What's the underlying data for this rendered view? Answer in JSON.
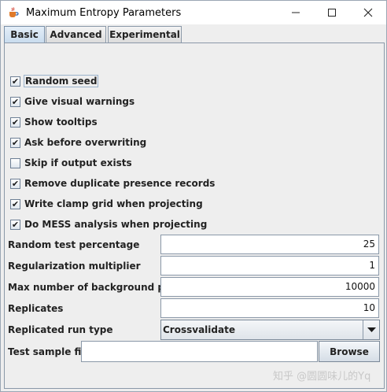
{
  "window": {
    "title": "Maximum Entropy Parameters",
    "controls": {
      "minimize": "—",
      "maximize": "☐",
      "close": "✕"
    }
  },
  "tabs": [
    {
      "label": "Basic",
      "active": true
    },
    {
      "label": "Advanced",
      "active": false
    },
    {
      "label": "Experimental",
      "active": false
    }
  ],
  "checkboxes": [
    {
      "label": "Random seed",
      "checked": true
    },
    {
      "label": "Give visual warnings",
      "checked": true
    },
    {
      "label": "Show tooltips",
      "checked": true
    },
    {
      "label": "Ask before overwriting",
      "checked": true
    },
    {
      "label": "Skip if output exists",
      "checked": false
    },
    {
      "label": "Remove duplicate presence records",
      "checked": true
    },
    {
      "label": "Write clamp grid when projecting",
      "checked": true
    },
    {
      "label": "Do MESS analysis when projecting",
      "checked": true
    }
  ],
  "fields": [
    {
      "label": "Random test percentage",
      "value": "25"
    },
    {
      "label": "Regularization multiplier",
      "value": "1"
    },
    {
      "label": "Max number of background points",
      "value": "10000"
    },
    {
      "label": "Replicates",
      "value": "10"
    }
  ],
  "replicated_run_type": {
    "label": "Replicated run type",
    "value": "Crossvalidate"
  },
  "test_sample_file": {
    "label": "Test sample file",
    "value": "",
    "button": "Browse"
  },
  "watermark": "知乎 @圆圆味儿的Yq",
  "icons": {
    "app": "java-cup-icon",
    "check": "checkmark-icon",
    "dropdown": "chevron-down-icon"
  }
}
